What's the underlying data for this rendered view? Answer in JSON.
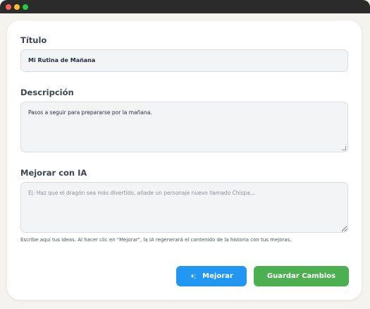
{
  "form": {
    "title_label": "Título",
    "title_value": "Mi Rutina de Mañana",
    "description_label": "Descripción",
    "description_value": "Pasos a seguir para prepararse por la mañana.",
    "ai_label": "Mejorar con IA",
    "ai_placeholder": "Ej: Haz que el dragón sea más divertido, añade un personaje nuevo llamado Chispa...",
    "ai_hint": "Escribe aquí tus ideas. Al hacer clic en \"Mejorar\", la IA regenerará el contenido de la historia con tus mejoras."
  },
  "buttons": {
    "improve_label": "Mejorar",
    "save_label": "Guardar Cambios"
  },
  "colors": {
    "improve_button": "#2196f3",
    "save_button": "#4caf50"
  },
  "icons": {
    "improve": "sparkle-icon"
  }
}
